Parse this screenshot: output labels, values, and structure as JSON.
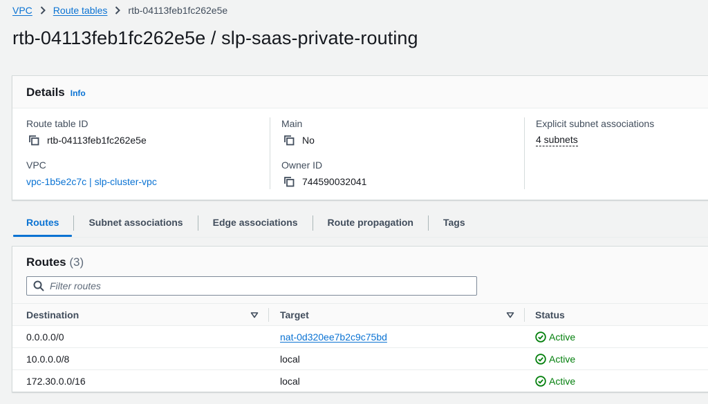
{
  "breadcrumb": {
    "items": [
      "VPC",
      "Route tables"
    ],
    "current": "rtb-04113feb1fc262e5e"
  },
  "page": {
    "title": "rtb-04113feb1fc262e5e / slp-saas-private-routing"
  },
  "details": {
    "heading": "Details",
    "info_link": "Info",
    "route_table_id": {
      "label": "Route table ID",
      "value": "rtb-04113feb1fc262e5e"
    },
    "vpc": {
      "label": "VPC",
      "value": "vpc-1b5e2c7c | slp-cluster-vpc"
    },
    "main": {
      "label": "Main",
      "value": "No"
    },
    "owner_id": {
      "label": "Owner ID",
      "value": "744590032041"
    },
    "subnet_associations": {
      "label": "Explicit subnet associations",
      "value": "4 subnets"
    }
  },
  "tabs": [
    {
      "label": "Routes",
      "active": true
    },
    {
      "label": "Subnet associations",
      "active": false
    },
    {
      "label": "Edge associations",
      "active": false
    },
    {
      "label": "Route propagation",
      "active": false
    },
    {
      "label": "Tags",
      "active": false
    }
  ],
  "routes": {
    "heading": "Routes",
    "count": "(3)",
    "filter_placeholder": "Filter routes",
    "columns": [
      "Destination",
      "Target",
      "Status"
    ],
    "rows": [
      {
        "destination": "0.0.0.0/0",
        "target": "nat-0d320ee7b2c9c75bd",
        "target_is_link": true,
        "status": "Active"
      },
      {
        "destination": "10.0.0.0/8",
        "target": "local",
        "target_is_link": false,
        "status": "Active"
      },
      {
        "destination": "172.30.0.0/16",
        "target": "local",
        "target_is_link": false,
        "status": "Active"
      }
    ]
  },
  "icons": {
    "breadcrumb_separator": "chevron-right-icon",
    "copy": "copy-icon",
    "search": "search-icon",
    "sort": "caret-down-icon",
    "status_ok": "check-circle-icon"
  },
  "colors": {
    "link": "#0972d3",
    "success": "#037f0c",
    "text": "#16191f",
    "background": "#f2f3f3"
  }
}
